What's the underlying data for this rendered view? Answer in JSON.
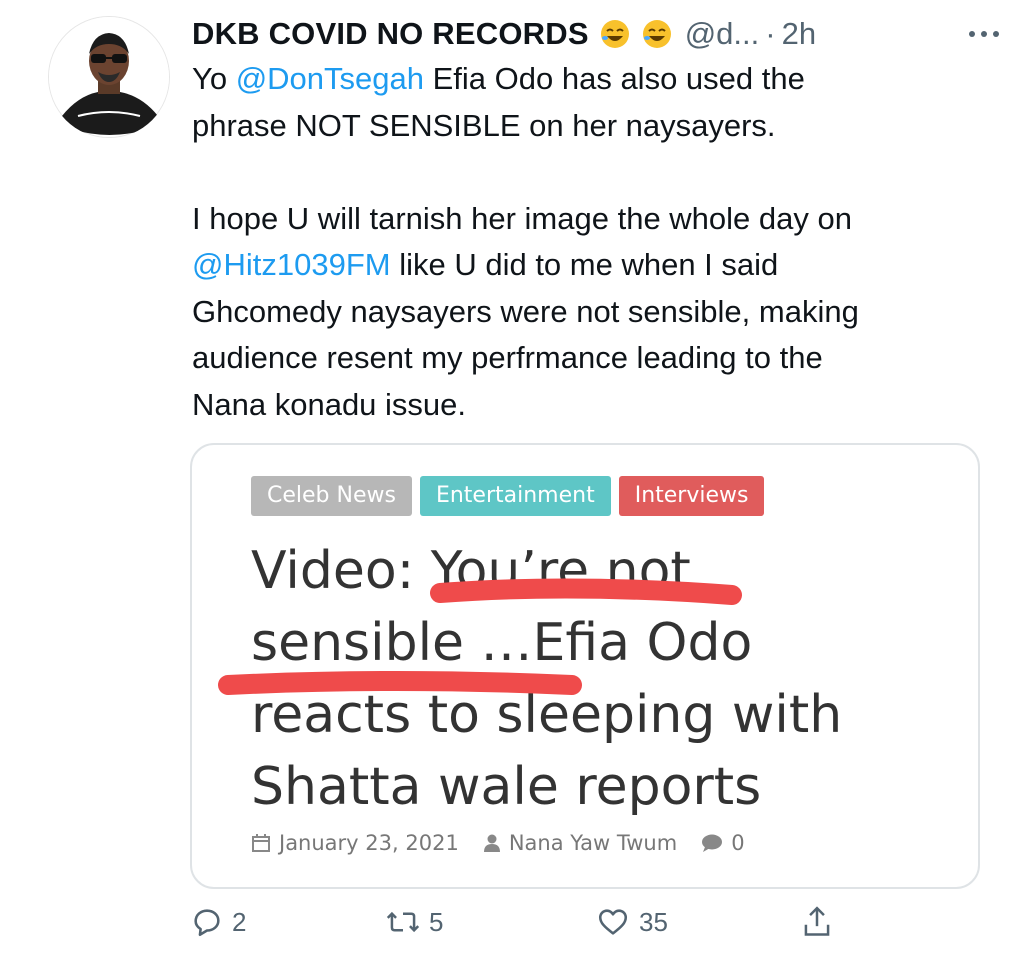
{
  "user": {
    "display_name": "DKB COVID NO RECORDS",
    "emoji_icons": [
      "rolling-on-floor-laughing-emoji",
      "rolling-on-floor-laughing-emoji"
    ],
    "handle": "@d...",
    "separator": "·",
    "time": "2h"
  },
  "tweet": {
    "lines": [
      {
        "segments": [
          {
            "text": "Yo "
          },
          {
            "text": "@DonTsegah",
            "mention": true
          },
          {
            "text": " Efia Odo has also used the"
          }
        ]
      },
      {
        "segments": [
          {
            "text": "phrase NOT SENSIBLE on her naysayers."
          }
        ]
      },
      {
        "segments": [
          {
            "text": ""
          }
        ]
      },
      {
        "segments": [
          {
            "text": "I hope U will tarnish her image the whole day on"
          }
        ]
      },
      {
        "segments": [
          {
            "text": "@Hitz1039FM",
            "mention": true
          },
          {
            "text": " like U did to me when I said"
          }
        ]
      },
      {
        "segments": [
          {
            "text": "Ghcomedy naysayers were not sensible, making"
          }
        ]
      },
      {
        "segments": [
          {
            "text": "audience resent my perfrmance leading to the"
          }
        ]
      },
      {
        "segments": [
          {
            "text": "Nana konadu issue."
          }
        ]
      }
    ]
  },
  "card": {
    "tags": {
      "celeb": "Celeb News",
      "entertainment": "Entertainment",
      "interviews": "Interviews"
    },
    "headline_lines": [
      "Video: You’re not",
      "sensible …Efia Odo",
      "reacts to sleeping with",
      "Shatta wale reports"
    ],
    "date": "January 23, 2021",
    "author": "Nana Yaw Twum",
    "comments": "0"
  },
  "actions": {
    "replies": "2",
    "retweets": "5",
    "likes": "35"
  },
  "colors": {
    "mention": "#1d9bf0",
    "tag_celeb": "#b7b7b7",
    "tag_entertainment": "#5ec6c6",
    "tag_interviews": "#e05c5c",
    "scribble": "#ef4b4b"
  }
}
